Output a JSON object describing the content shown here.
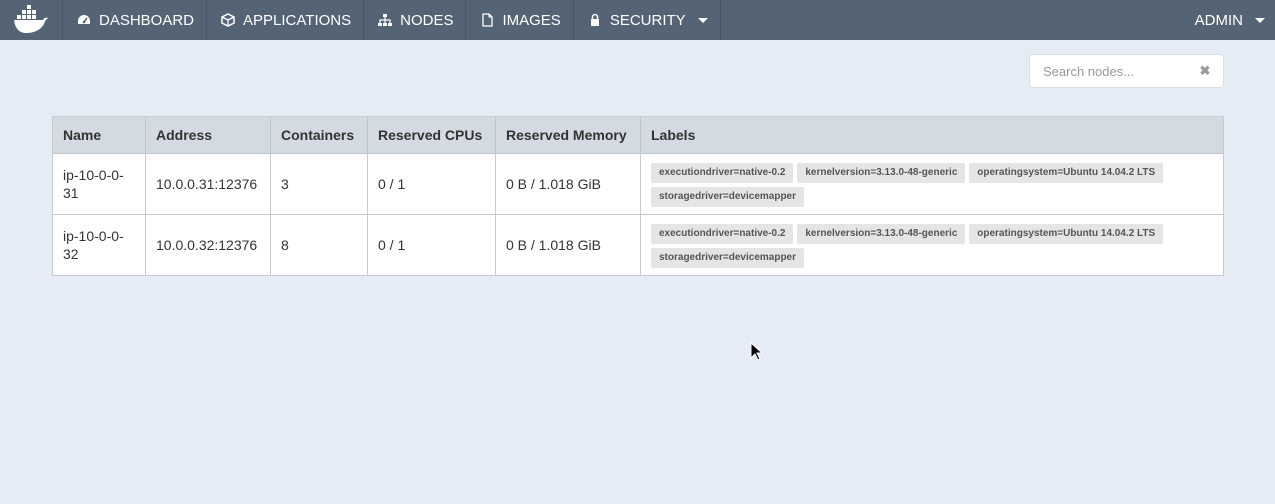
{
  "nav": {
    "items": [
      {
        "label": "DASHBOARD",
        "icon": "dashboard-icon"
      },
      {
        "label": "APPLICATIONS",
        "icon": "cube-icon"
      },
      {
        "label": "NODES",
        "icon": "sitemap-icon"
      },
      {
        "label": "IMAGES",
        "icon": "file-icon"
      },
      {
        "label": "SECURITY",
        "icon": "lock-icon"
      }
    ],
    "user": "ADMIN",
    "bar_color": "#546475"
  },
  "search": {
    "placeholder": "Search nodes..."
  },
  "table": {
    "headers": [
      "Name",
      "Address",
      "Containers",
      "Reserved CPUs",
      "Reserved Memory",
      "Labels"
    ],
    "rows": [
      {
        "name": "ip-10-0-0-31",
        "address": "10.0.0.31:12376",
        "containers": "3",
        "cpus": "0 / 1",
        "memory": "0 B / 1.018 GiB",
        "labels": [
          "executiondriver=native-0.2",
          "kernelversion=3.13.0-48-generic",
          "operatingsystem=Ubuntu 14.04.2 LTS",
          "storagedriver=devicemapper"
        ]
      },
      {
        "name": "ip-10-0-0-32",
        "address": "10.0.0.32:12376",
        "containers": "8",
        "cpus": "0 / 1",
        "memory": "0 B / 1.018 GiB",
        "labels": [
          "executiondriver=native-0.2",
          "kernelversion=3.13.0-48-generic",
          "operatingsystem=Ubuntu 14.04.2 LTS",
          "storagedriver=devicemapper"
        ]
      }
    ]
  }
}
